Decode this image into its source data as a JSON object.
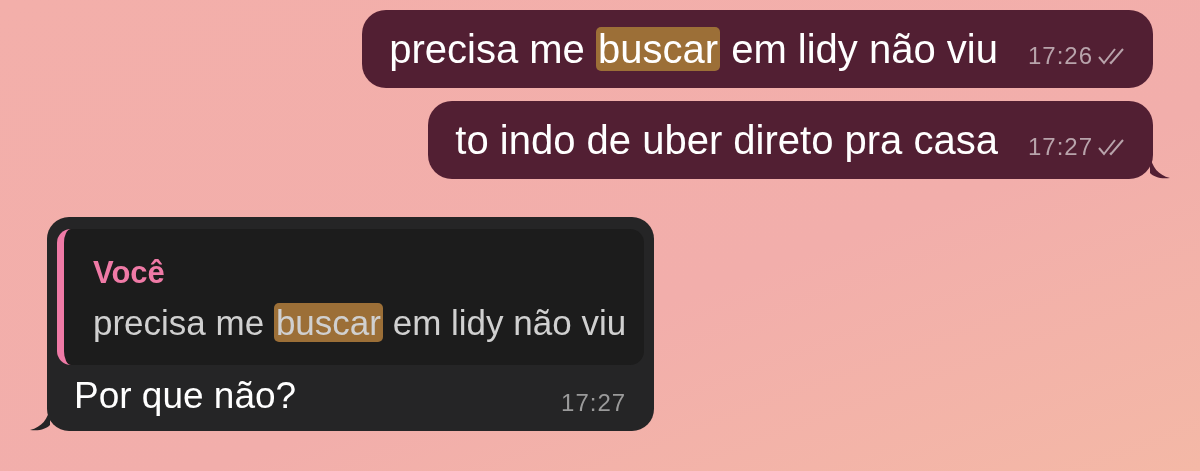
{
  "messages": [
    {
      "kind": "outgoing",
      "parts": [
        {
          "text": "precisa me ",
          "highlighted": false
        },
        {
          "text": "buscar",
          "highlighted": true
        },
        {
          "text": " em lidy não viu",
          "highlighted": false
        }
      ],
      "time": "17:26",
      "read": true,
      "tail": false
    },
    {
      "kind": "outgoing",
      "parts": [
        {
          "text": "to indo de uber direto pra casa",
          "highlighted": false
        }
      ],
      "time": "17:27",
      "read": true,
      "tail": true
    },
    {
      "kind": "incoming",
      "reply": {
        "author": "Você",
        "parts": [
          {
            "text": "precisa me ",
            "highlighted": false
          },
          {
            "text": "buscar",
            "highlighted": true
          },
          {
            "text": " em lidy não viu",
            "highlighted": false
          }
        ]
      },
      "parts": [
        {
          "text": "Por que não?",
          "highlighted": false
        }
      ],
      "time": "17:27",
      "tail": true
    }
  ]
}
